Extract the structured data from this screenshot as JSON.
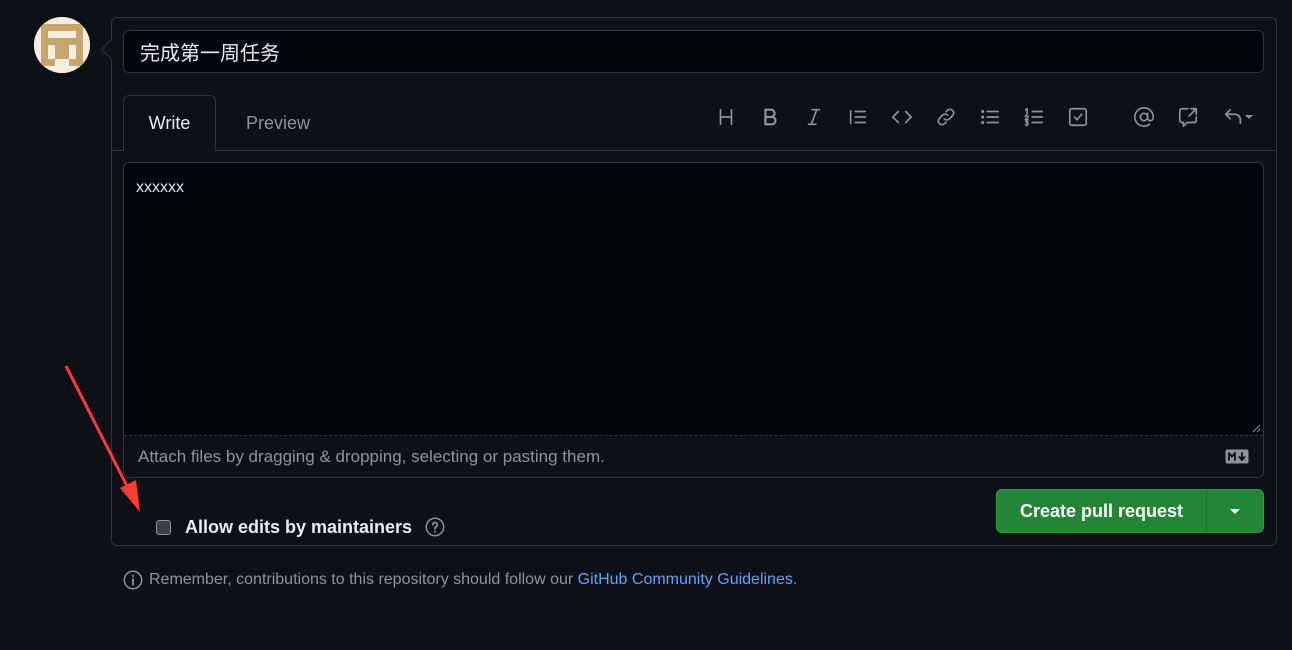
{
  "pr_form": {
    "title_value": "完成第一周任务",
    "tabs": [
      {
        "label": "Write",
        "active": true
      },
      {
        "label": "Preview",
        "active": false
      }
    ],
    "toolbar_icons": [
      "heading-icon",
      "bold-icon",
      "italic-icon",
      "quote-icon",
      "code-icon",
      "link-icon",
      "unordered-list-icon",
      "ordered-list-icon",
      "task-list-icon",
      "mention-icon",
      "reference-icon",
      "reply-icon"
    ],
    "body_text": "xxxxxx",
    "attach_hint": "Attach files by dragging & dropping, selecting or pasting them.",
    "allow_edits_label": "Allow edits by maintainers",
    "allow_edits_checked": false,
    "create_button_label": "Create pull request"
  },
  "footer": {
    "remember_prefix": "Remember, contributions to this repository should follow our ",
    "guidelines_link": "GitHub Community Guidelines",
    "remember_suffix": "."
  },
  "colors": {
    "background": "#0d1117",
    "button_green": "#238636",
    "link_blue": "#58a6ff",
    "annotation_arrow": "#ff3b30"
  }
}
